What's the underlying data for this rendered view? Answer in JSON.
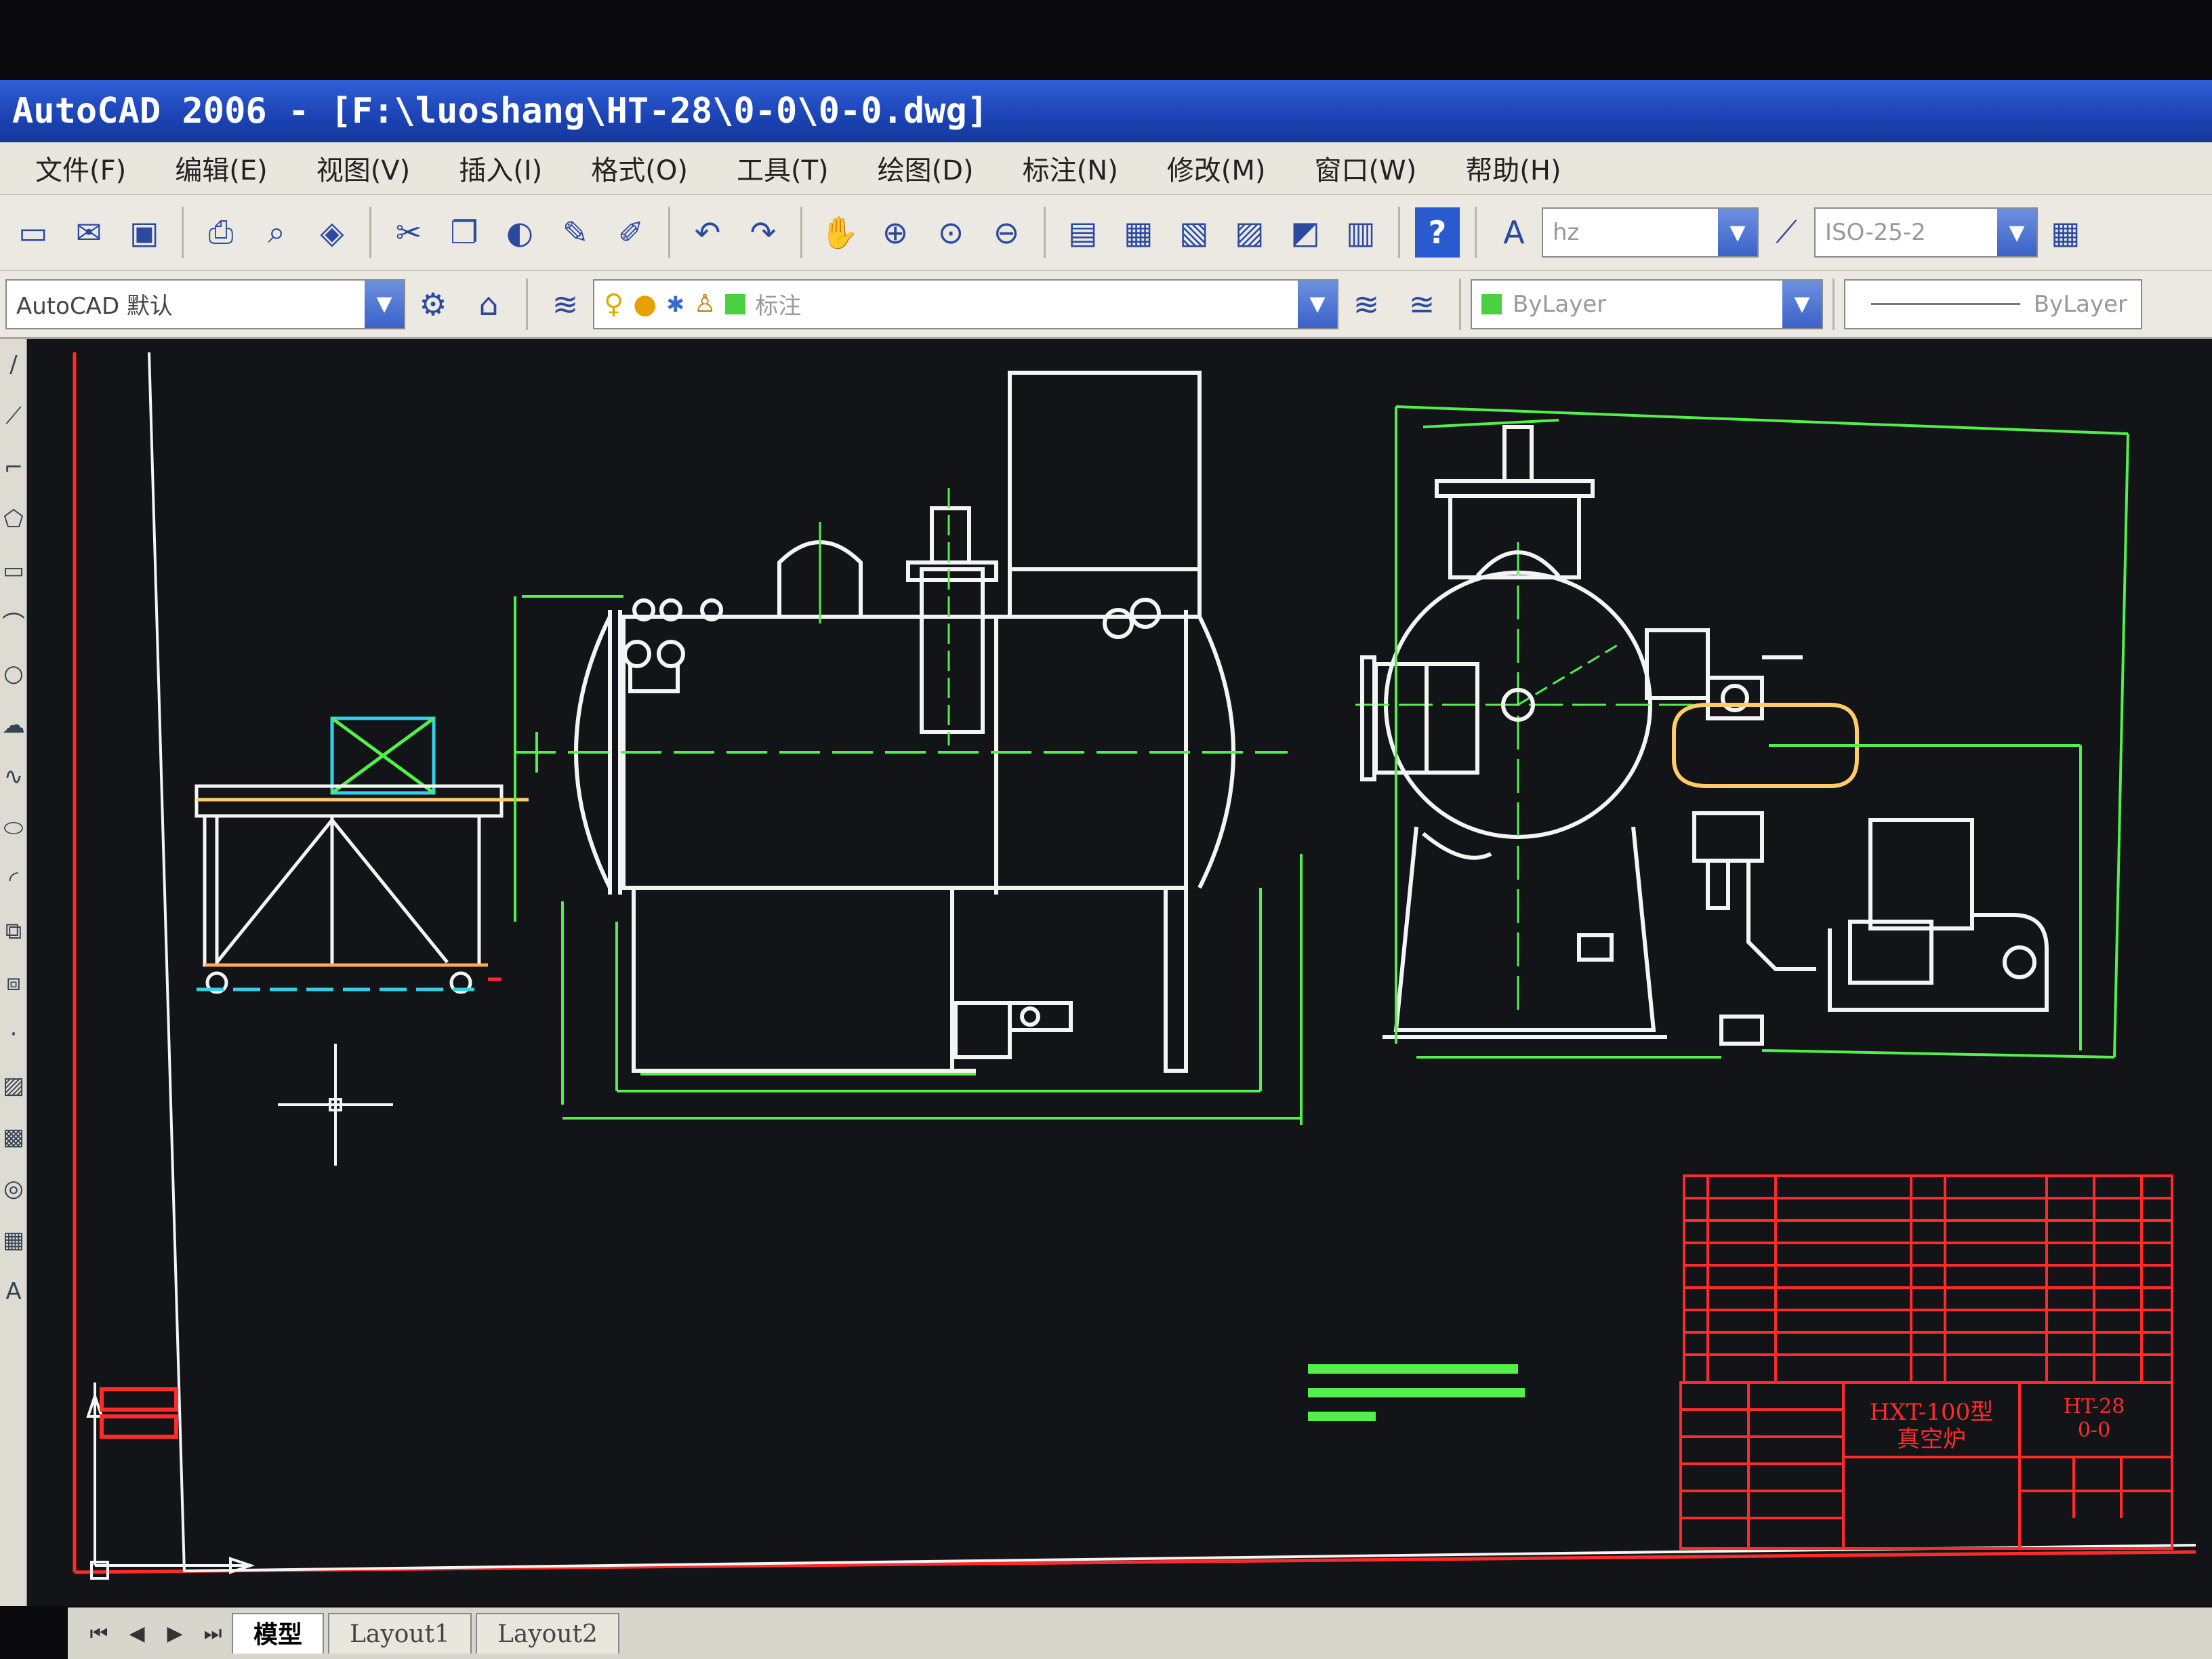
{
  "window": {
    "title": "AutoCAD 2006 - [F:\\luoshang\\HT-28\\0-0\\0-0.dwg]"
  },
  "menu": {
    "items": [
      "文件(F)",
      "编辑(E)",
      "视图(V)",
      "插入(I)",
      "格式(O)",
      "工具(T)",
      "绘图(D)",
      "标注(N)",
      "修改(M)",
      "窗口(W)",
      "帮助(H)"
    ]
  },
  "toolbar": {
    "text_style_value": "hz",
    "dim_style_value": "ISO-25-2",
    "workspace_value": "AutoCAD 默认",
    "layer_value": "标注",
    "color_value": "ByLayer",
    "linetype_value": "ByLayer"
  },
  "drawing": {
    "title_block_name_line1": "HXT-100型",
    "title_block_name_line2": "真空炉",
    "title_block_drawing_no": "HT-28",
    "title_block_sheet": "0-0"
  },
  "tabs": {
    "items": [
      "模型",
      "Layout1",
      "Layout2"
    ],
    "active": "模型"
  },
  "colors": {
    "cad_background": "#121418",
    "line_white": "#f4f4f4",
    "line_green": "#52f04a",
    "line_red": "#ff2b2b",
    "line_cyan": "#34d0e8",
    "titlebar_blue": "#1b43b4"
  },
  "icons": {
    "toolbar1": [
      "new-icon",
      "open-icon",
      "save-icon",
      "print-icon",
      "plot-preview-icon",
      "publish-icon",
      "cut-icon",
      "copy-icon",
      "paste-icon",
      "match-properties-icon",
      "block-editor-icon",
      "undo-icon",
      "redo-icon",
      "pan-icon",
      "zoom-realtime-icon",
      "zoom-window-icon",
      "zoom-previous-icon",
      "properties-icon",
      "design-center-icon",
      "tool-palettes-icon",
      "sheet-set-icon",
      "markup-icon",
      "calculator-icon",
      "help-icon",
      "text-style-icon",
      "dim-style-icon",
      "table-style-icon"
    ],
    "left": [
      "line-icon",
      "construction-line-icon",
      "polyline-icon",
      "polygon-icon",
      "rectangle-icon",
      "arc-icon",
      "circle-icon",
      "revcloud-icon",
      "spline-icon",
      "ellipse-icon",
      "ellipse-arc-icon",
      "insert-block-icon",
      "make-block-icon",
      "point-icon",
      "hatch-icon",
      "gradient-icon",
      "region-icon",
      "table-icon",
      "mtext-icon"
    ]
  }
}
